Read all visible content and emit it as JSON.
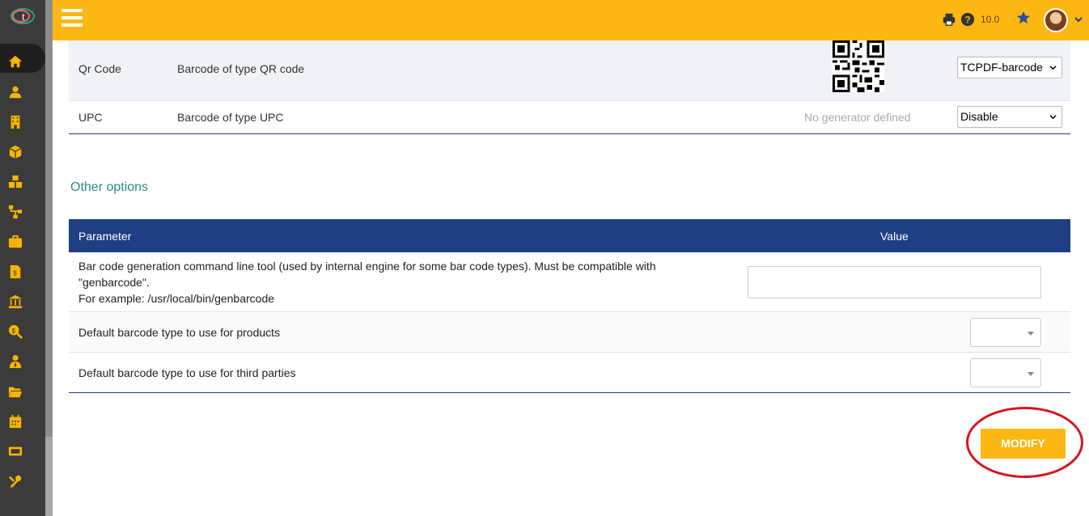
{
  "app": {
    "logo_icon": "dolibarr-logo",
    "accent_color": "#fcb712",
    "header_color": "#1e3f84"
  },
  "topbar": {
    "menu_icon": "hamburger-icon",
    "print_icon": "printer-icon",
    "help_icon": "help-circle-icon",
    "version": "10.0",
    "bookmark_icon": "star-icon",
    "user_icon": "avatar"
  },
  "sidebar": {
    "items": [
      {
        "icon": "home-icon"
      },
      {
        "icon": "user-icon"
      },
      {
        "icon": "building-icon"
      },
      {
        "icon": "box-icon"
      },
      {
        "icon": "cubes-icon"
      },
      {
        "icon": "sitemap-icon"
      },
      {
        "icon": "briefcase-icon"
      },
      {
        "icon": "invoice-icon"
      },
      {
        "icon": "bank-icon"
      },
      {
        "icon": "search-dollar-icon"
      },
      {
        "icon": "user-tie-icon"
      },
      {
        "icon": "folder-open-icon"
      },
      {
        "icon": "calendar-icon"
      },
      {
        "icon": "ticket-icon"
      },
      {
        "icon": "tools-icon"
      }
    ]
  },
  "barcode_types": [
    {
      "name": "Qr Code",
      "description": "Barcode of type QR code",
      "generator_text": "",
      "selected": "TCPDF-barcode"
    },
    {
      "name": "UPC",
      "description": "Barcode of type UPC",
      "generator_text": "No generator defined",
      "selected": "Disable"
    }
  ],
  "other_options": {
    "title": "Other options",
    "columns": {
      "parameter": "Parameter",
      "value": "Value"
    },
    "rows": [
      {
        "line1": "Bar code generation command line tool (used by internal engine for some bar code types). Must be compatible with",
        "line2": "\"genbarcode\".",
        "line3": "For example: /usr/local/bin/genbarcode",
        "value": ""
      },
      {
        "label": "Default barcode type to use for products",
        "value": ""
      },
      {
        "label": "Default barcode type to use for third parties",
        "value": ""
      }
    ]
  },
  "actions": {
    "modify_label": "MODIFY"
  }
}
